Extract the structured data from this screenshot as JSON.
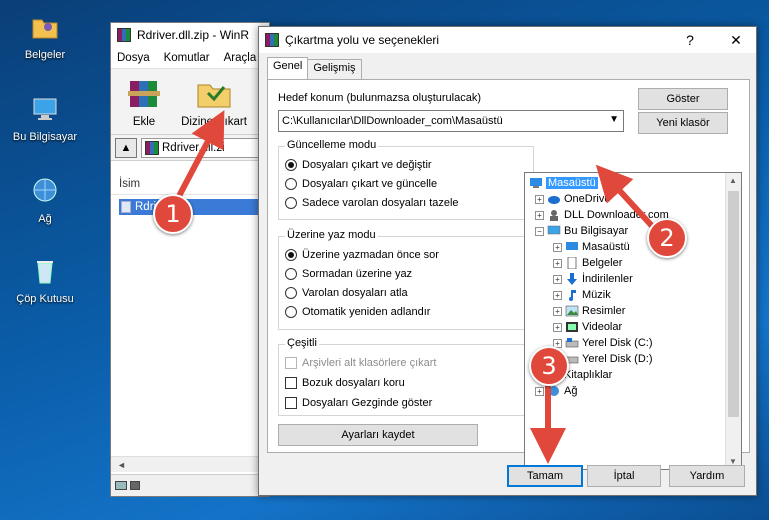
{
  "desktop": {
    "icons": [
      {
        "label": "Belgeler",
        "icon": "folder-icon"
      },
      {
        "label": "Bu Bilgisayar",
        "icon": "computer-icon"
      },
      {
        "label": "Ağ",
        "icon": "network-icon"
      },
      {
        "label": "Çöp Kutusu",
        "icon": "recycle-bin-icon"
      }
    ]
  },
  "winrar": {
    "title": "Rdriver.dll.zip - WinR",
    "menu": [
      "Dosya",
      "Komutlar",
      "Araçla"
    ],
    "toolbar": {
      "add": "Ekle",
      "extract_to": "Dizine Çıkart"
    },
    "address": "Rdriver.dll.zi",
    "column_name": "İsim",
    "file": "Rdriver.dll",
    "scroll_left": "◄"
  },
  "dialog": {
    "title": "Çıkartma yolu ve seçenekleri",
    "help": "?",
    "close": "✕",
    "tabs": [
      "Genel",
      "Gelişmiş"
    ],
    "dest_label": "Hedef konum (bulunmazsa oluşturulacak)",
    "dest_value": "C:\\Kullanıcılar\\DllDownloader_com\\Masaüstü",
    "show_button": "Göster",
    "new_folder_button": "Yeni klasör",
    "update_mode": {
      "title": "Güncelleme modu",
      "options": [
        "Dosyaları çıkart ve değiştir",
        "Dosyaları çıkart ve güncelle",
        "Sadece varolan dosyaları tazele"
      ],
      "selected": 0
    },
    "overwrite_mode": {
      "title": "Üzerine yaz modu",
      "options": [
        "Üzerine yazmadan önce sor",
        "Sormadan üzerine yaz",
        "Varolan dosyaları atla",
        "Otomatik yeniden adlandır"
      ],
      "selected": 0
    },
    "misc": {
      "title": "Çeşitli",
      "options": [
        "Arşivleri alt klasörlere çıkart",
        "Bozuk dosyaları koru",
        "Dosyaları Gezginde göster"
      ]
    },
    "save_settings": "Ayarları kaydet",
    "tree": [
      {
        "label": "Masaüstü",
        "icon": "desktop-icon",
        "selected": true
      },
      {
        "label": "OneDrive",
        "icon": "cloud-icon"
      },
      {
        "label": "DLL Downloader.com",
        "icon": "user-icon"
      },
      {
        "label": "Bu Bilgisayar",
        "icon": "computer-icon"
      },
      {
        "label": "Masaüstü",
        "icon": "desktop-icon"
      },
      {
        "label": "Belgeler",
        "icon": "document-icon"
      },
      {
        "label": "İndirilenler",
        "icon": "download-icon"
      },
      {
        "label": "Müzik",
        "icon": "music-icon"
      },
      {
        "label": "Resimler",
        "icon": "pictures-icon"
      },
      {
        "label": "Videolar",
        "icon": "video-icon"
      },
      {
        "label": "Yerel Disk (C:)",
        "icon": "drive-icon"
      },
      {
        "label": "Yerel Disk (D:)",
        "icon": "drive-icon"
      },
      {
        "label": "Kitaplıklar",
        "icon": "folder-icon"
      },
      {
        "label": "Ağ",
        "icon": "network-icon"
      }
    ],
    "ok_button": "Tamam",
    "cancel_button": "İptal",
    "help_button": "Yardım"
  },
  "annotations": [
    "1",
    "2",
    "3"
  ],
  "colors": {
    "accent": "#0078d7",
    "selection": "#3399ff",
    "marker": "#e0483c"
  }
}
